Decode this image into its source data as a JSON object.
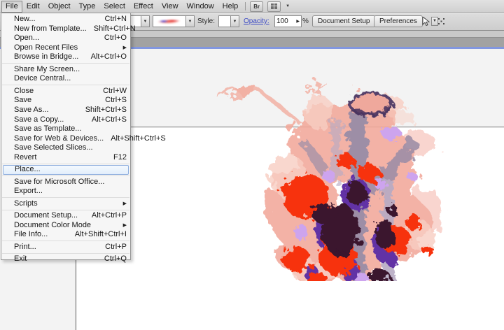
{
  "menu_bar": {
    "items": [
      "File",
      "Edit",
      "Object",
      "Type",
      "Select",
      "Effect",
      "View",
      "Window",
      "Help"
    ],
    "open_item": "File",
    "bridge_button_label": "Br",
    "arrange_caret": "▼"
  },
  "control_bar": {
    "style_label": "Style:",
    "opacity_label": "Opacity:",
    "opacity_value": "100",
    "opacity_spinner": "▶",
    "percent_label": "%",
    "document_setup_label": "Document Setup",
    "preferences_label": "Preferences",
    "combo_caret": "▼"
  },
  "file_menu": {
    "items": [
      {
        "label": "New...",
        "shortcut": "Ctrl+N"
      },
      {
        "label": "New from Template...",
        "shortcut": "Shift+Ctrl+N"
      },
      {
        "label": "Open...",
        "shortcut": "Ctrl+O"
      },
      {
        "label": "Open Recent Files",
        "submenu": true
      },
      {
        "label": "Browse in Bridge...",
        "shortcut": "Alt+Ctrl+O"
      },
      {
        "separator": true
      },
      {
        "label": "Share My Screen..."
      },
      {
        "label": "Device Central..."
      },
      {
        "separator": true
      },
      {
        "label": "Close",
        "shortcut": "Ctrl+W"
      },
      {
        "label": "Save",
        "shortcut": "Ctrl+S"
      },
      {
        "label": "Save As...",
        "shortcut": "Shift+Ctrl+S"
      },
      {
        "label": "Save a Copy...",
        "shortcut": "Alt+Ctrl+S"
      },
      {
        "label": "Save as Template..."
      },
      {
        "label": "Save for Web & Devices...",
        "shortcut": "Alt+Shift+Ctrl+S"
      },
      {
        "label": "Save Selected Slices..."
      },
      {
        "label": "Revert",
        "shortcut": "F12"
      },
      {
        "separator": true
      },
      {
        "label": "Place...",
        "highlighted": true
      },
      {
        "separator": true
      },
      {
        "label": "Save for Microsoft Office..."
      },
      {
        "label": "Export..."
      },
      {
        "separator": true
      },
      {
        "label": "Scripts",
        "submenu": true
      },
      {
        "separator": true
      },
      {
        "label": "Document Setup...",
        "shortcut": "Alt+Ctrl+P"
      },
      {
        "label": "Document Color Mode",
        "submenu": true
      },
      {
        "label": "File Info...",
        "shortcut": "Alt+Shift+Ctrl+I"
      },
      {
        "separator": true
      },
      {
        "label": "Print...",
        "shortcut": "Ctrl+P"
      },
      {
        "separator": true
      },
      {
        "label": "Exit",
        "shortcut": "Ctrl+Q"
      }
    ]
  },
  "artwork": {
    "alt": "abstract-watercolor-splatter-figure",
    "palette": {
      "salmon": "#f2a89a",
      "salmon_light": "#f8cec3",
      "red": "#f73108",
      "plum_dark": "#3a142e",
      "violet": "#6233a5",
      "lavender": "#cda4ee",
      "gray_purple": "#9d8ea6",
      "gray_purple_light": "#b7abc4",
      "head_fill": "#efa89c",
      "head_stroke": "#54406a"
    }
  }
}
